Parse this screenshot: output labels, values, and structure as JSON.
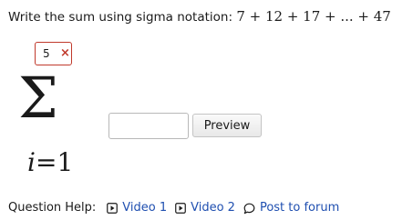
{
  "question": {
    "prompt": "Write the sum using sigma notation:",
    "expression": "7 + 12 + 17 + ... + 47"
  },
  "sigma_entry": {
    "upper_limit_value": "5",
    "upper_limit_status": "×",
    "symbol": "Σ",
    "lower_limit_variable": "i",
    "lower_limit_equals": "=",
    "lower_limit_value": "1"
  },
  "answer": {
    "value": "",
    "preview_label": "Preview"
  },
  "help": {
    "label": "Question Help:",
    "links": [
      {
        "label": "Video 1",
        "icon": "play-icon"
      },
      {
        "label": "Video 2",
        "icon": "play-icon"
      },
      {
        "label": "Post to forum",
        "icon": "speech-bubble-icon"
      }
    ]
  },
  "colors": {
    "error": "#c0392b",
    "link": "#1f4fb0"
  }
}
